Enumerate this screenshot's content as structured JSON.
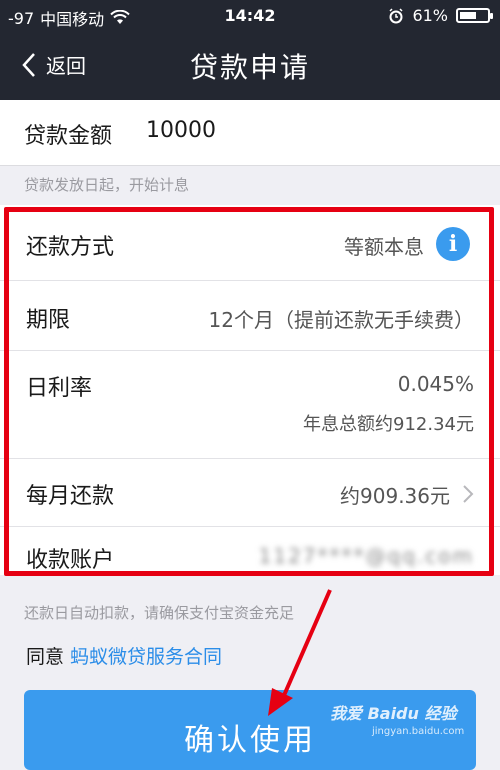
{
  "status_bar": {
    "signal": "-97",
    "carrier": "中国移动",
    "time": "14:42",
    "battery_pct": "61%",
    "battery_level": 0.61
  },
  "nav": {
    "back_label": "返回",
    "title": "贷款申请"
  },
  "amount": {
    "label": "贷款金额",
    "value": "10000"
  },
  "hint_interest": "贷款发放日起，开始计息",
  "details": {
    "repay_method": {
      "label": "还款方式",
      "value": "等额本息"
    },
    "term": {
      "label": "期限",
      "value": "12个月（提前还款无手续费）"
    },
    "daily_rate": {
      "label": "日利率",
      "value": "0.045%",
      "sub": "年息总额约912.34元"
    },
    "monthly": {
      "label": "每月还款",
      "value": "约909.36元"
    },
    "account": {
      "label": "收款账户",
      "value": "1127****@qq.com"
    }
  },
  "hint_autodebit": "还款日自动扣款，请确保支付宝资金充足",
  "agreement": {
    "prefix": "同意 ",
    "link": "蚂蚁微贷服务合同"
  },
  "confirm_label": "确认使用",
  "watermark": {
    "main": "我爱 Baidu 经验",
    "sub": "jingyan.baidu.com"
  },
  "colors": {
    "header_bg": "#232731",
    "accent": "#3a9bee",
    "link": "#2b8de8",
    "highlight": "#e60012"
  }
}
